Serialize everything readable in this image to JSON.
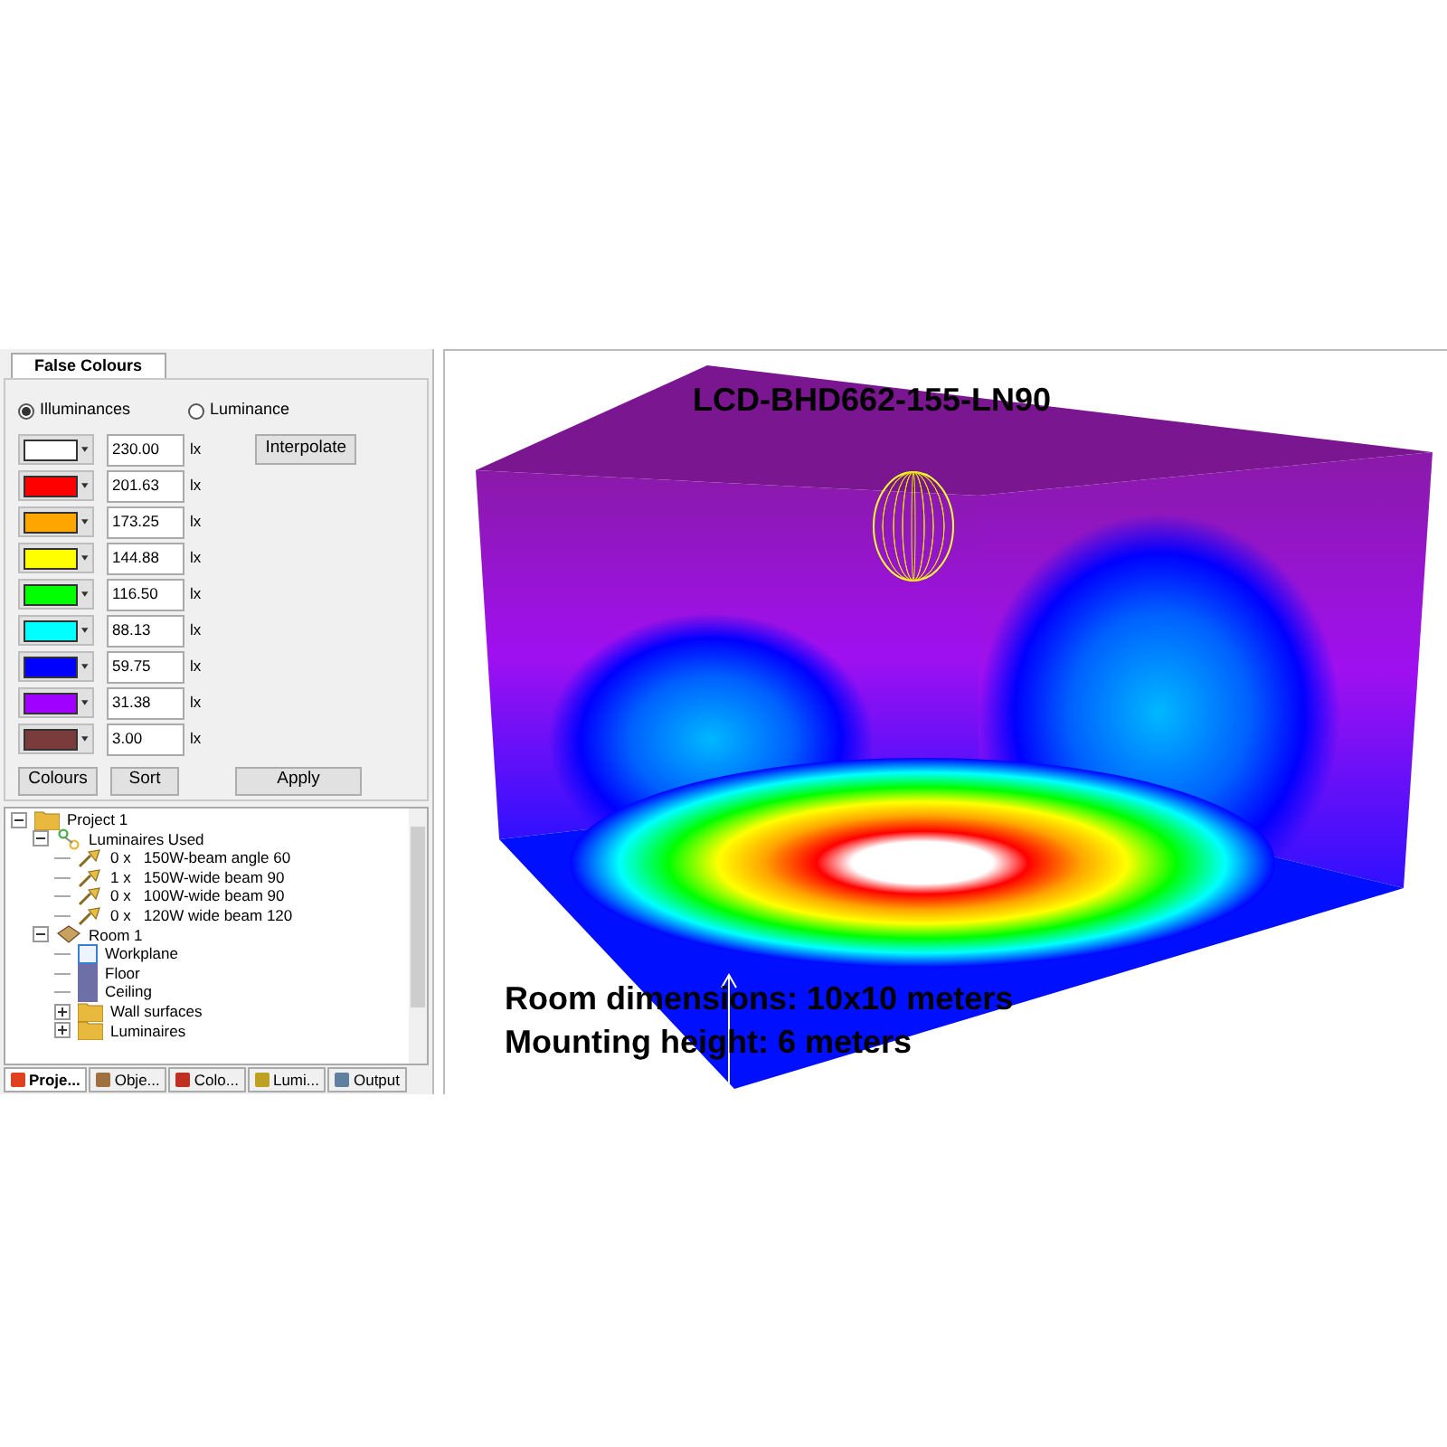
{
  "panel_tab": {
    "label": "False Colours",
    "selected": true
  },
  "mode_options": [
    {
      "label": "Illuminances",
      "selected": true
    },
    {
      "label": "Luminance",
      "selected": false
    }
  ],
  "colour_scale": [
    {
      "color": "#ffffff",
      "value": "230.00",
      "unit": "lx"
    },
    {
      "color": "#ff0000",
      "value": "201.63",
      "unit": "lx"
    },
    {
      "color": "#ffa500",
      "value": "173.25",
      "unit": "lx"
    },
    {
      "color": "#ffff00",
      "value": "144.88",
      "unit": "lx"
    },
    {
      "color": "#00ff00",
      "value": "116.50",
      "unit": "lx"
    },
    {
      "color": "#00ffff",
      "value": "88.13",
      "unit": "lx"
    },
    {
      "color": "#0000ff",
      "value": "59.75",
      "unit": "lx"
    },
    {
      "color": "#a000ff",
      "value": "31.38",
      "unit": "lx"
    },
    {
      "color": "#7a3b3b",
      "value": "3.00",
      "unit": "lx"
    }
  ],
  "buttons": {
    "interpolate": "Interpolate",
    "colours": "Colours",
    "sort": "Sort",
    "apply": "Apply"
  },
  "tree": [
    {
      "label": "Project 1",
      "kind": "folder",
      "expanded": true,
      "children": [
        {
          "label": "Luminaires Used",
          "kind": "group",
          "expanded": true,
          "children": [
            {
              "label": "0 x   150W-beam angle 60",
              "kind": "lamp"
            },
            {
              "label": "1 x   150W-wide beam 90",
              "kind": "lamp"
            },
            {
              "label": "0 x   100W-wide beam 90",
              "kind": "lamp"
            },
            {
              "label": "0 x   120W wide beam 120",
              "kind": "lamp"
            }
          ]
        },
        {
          "label": "Room 1",
          "kind": "room",
          "expanded": true,
          "children": [
            {
              "label": "Workplane",
              "kind": "plane"
            },
            {
              "label": "Floor",
              "kind": "surface"
            },
            {
              "label": "Ceiling",
              "kind": "surface"
            },
            {
              "label": "Wall surfaces",
              "kind": "folder",
              "expanded": false
            },
            {
              "label": "Luminaires",
              "kind": "folder",
              "expanded": false
            }
          ]
        }
      ]
    }
  ],
  "bottom_tabs": [
    {
      "label": "Proje...",
      "selected": true
    },
    {
      "label": "Obje...",
      "selected": false
    },
    {
      "label": "Colo...",
      "selected": false
    },
    {
      "label": "Lumi...",
      "selected": false
    },
    {
      "label": "Output",
      "selected": false
    }
  ],
  "viewport": {
    "title": "LCD-BHD662-155-LN90",
    "caption": [
      "Room dimensions: 10x10 meters",
      "Mounting height: 6 meters"
    ]
  }
}
